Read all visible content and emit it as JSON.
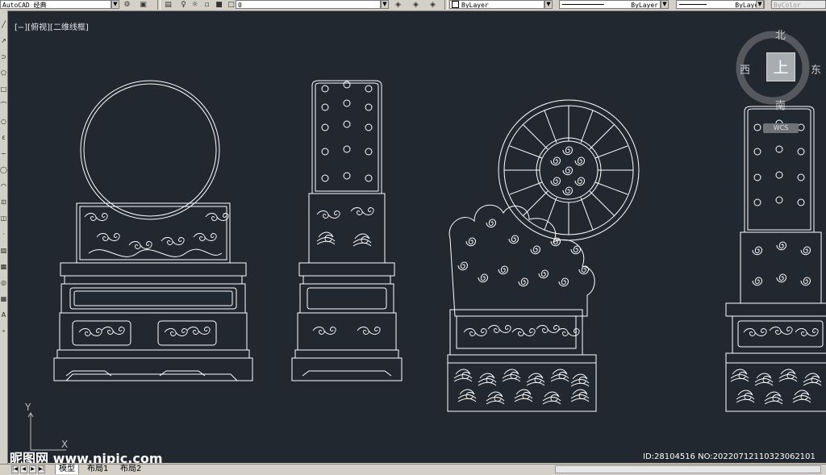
{
  "toolbar": {
    "workspace": "AutoCAD 经典",
    "layer_value": "0",
    "color_value": "ByLayer",
    "linetype_value": "ByLayer",
    "lineweight_value": "ByLayer",
    "plotstyle_value": "ByColor"
  },
  "viewport": {
    "label": "[−][俯视][二维线框]"
  },
  "viewcube": {
    "north": "北",
    "south": "南",
    "east": "东",
    "west": "西",
    "top": "上",
    "wcs": "WCS"
  },
  "ucs": {
    "x": "X",
    "y": "Y"
  },
  "tabs": {
    "model": "模型",
    "layout1": "布局1",
    "layout2": "布局2"
  },
  "watermark": {
    "site": "昵图网 www.nipic.com",
    "id": "ID:28104516 NO:20220712110323062101"
  },
  "colors": {
    "canvas_bg": "#212830",
    "line": "#ffffff",
    "ui_gray": "#d4d0c8"
  },
  "icons": {
    "left_toolbar": [
      "line-icon",
      "construction-line-icon",
      "polyline-icon",
      "polygon-icon",
      "rectangle-icon",
      "arc-icon",
      "circle-icon",
      "revision-cloud-icon",
      "spline-icon",
      "ellipse-icon",
      "ellipse-arc-icon",
      "insert-block-icon",
      "make-block-icon",
      "point-icon",
      "hatch-icon",
      "gradient-icon",
      "region-icon",
      "table-icon",
      "multiline-text-icon",
      "add-selected-icon"
    ]
  }
}
